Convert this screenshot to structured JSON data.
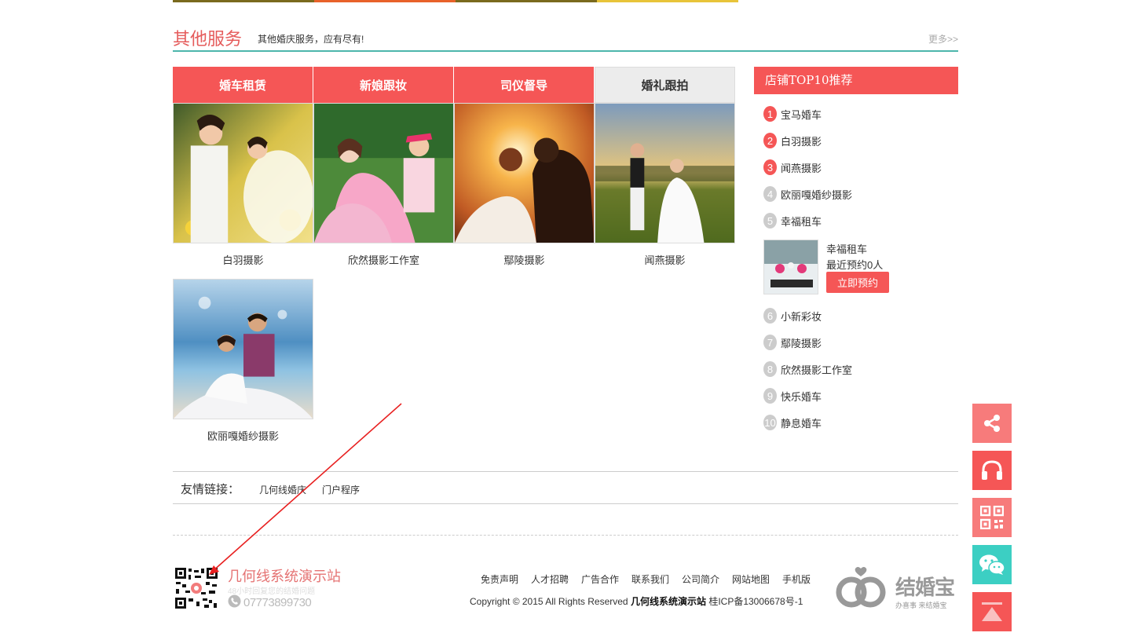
{
  "topbar_colors": [
    "#7a6a1e",
    "#e8622a",
    "#7a6a1e",
    "#e8c43a"
  ],
  "section": {
    "title": "其他服务",
    "subtitle": "其他婚庆服务，应有尽有!",
    "more": "更多>>"
  },
  "tabs": [
    {
      "label": "婚车租赁",
      "active": true
    },
    {
      "label": "新娘跟妆",
      "active": true
    },
    {
      "label": "司仪督导",
      "active": true
    },
    {
      "label": "婚礼跟拍",
      "active": false
    }
  ],
  "gallery": [
    {
      "name": "白羽摄影"
    },
    {
      "name": "欣然摄影工作室"
    },
    {
      "name": "鄢陵摄影"
    },
    {
      "name": "闻燕摄影"
    },
    {
      "name": "欧丽嘎婚纱摄影"
    }
  ],
  "sidebar": {
    "title": "店铺TOP10推荐",
    "top": [
      {
        "num": "1",
        "name": "宝马婚车"
      },
      {
        "num": "2",
        "name": "白羽摄影"
      },
      {
        "num": "3",
        "name": "闻燕摄影"
      },
      {
        "num": "4",
        "name": "欧丽嘎婚纱摄影"
      },
      {
        "num": "5",
        "name": "幸福租车"
      }
    ],
    "featured": {
      "name": "幸福租车",
      "count": "最近预约0人",
      "button": "立即预约"
    },
    "rest": [
      {
        "num": "6",
        "name": "小新彩妆"
      },
      {
        "num": "7",
        "name": "鄢陵摄影"
      },
      {
        "num": "8",
        "name": "欣然摄影工作室"
      },
      {
        "num": "9",
        "name": "快乐婚车"
      },
      {
        "num": "10",
        "name": "静息婚车"
      }
    ]
  },
  "links": {
    "label": "友情链接：",
    "items": [
      "几何线婚庆",
      "门户程序"
    ]
  },
  "footer": {
    "site_name": "几何线系统演示站",
    "site_tag": "48小时回复您的结婚问题",
    "phone": "07773899730",
    "nav": [
      "免责声明",
      "人才招聘",
      "广告合作",
      "联系我们",
      "公司简介",
      "网站地图",
      "手机版"
    ],
    "copyright": "Copyright © 2015  All Rights Reserved",
    "copyright_site": "几何线系统演示站",
    "icp": "桂ICP备13006678号-1",
    "brand_name": "结婚宝",
    "brand_tag": "办喜事 来结婚宝"
  },
  "floating_buttons": [
    {
      "icon": "share-icon",
      "color": "#f77b7b"
    },
    {
      "icon": "headphones-icon",
      "color": "#f55656"
    },
    {
      "icon": "qr-code-icon",
      "color": "#f77b7b"
    },
    {
      "icon": "wechat-icon",
      "color": "#3ccfc3"
    },
    {
      "icon": "back-to-top-icon",
      "color": "#f55656"
    }
  ],
  "colors": {
    "accent": "#f55656",
    "title": "#e55b5b",
    "underline": "#4db6ac"
  }
}
